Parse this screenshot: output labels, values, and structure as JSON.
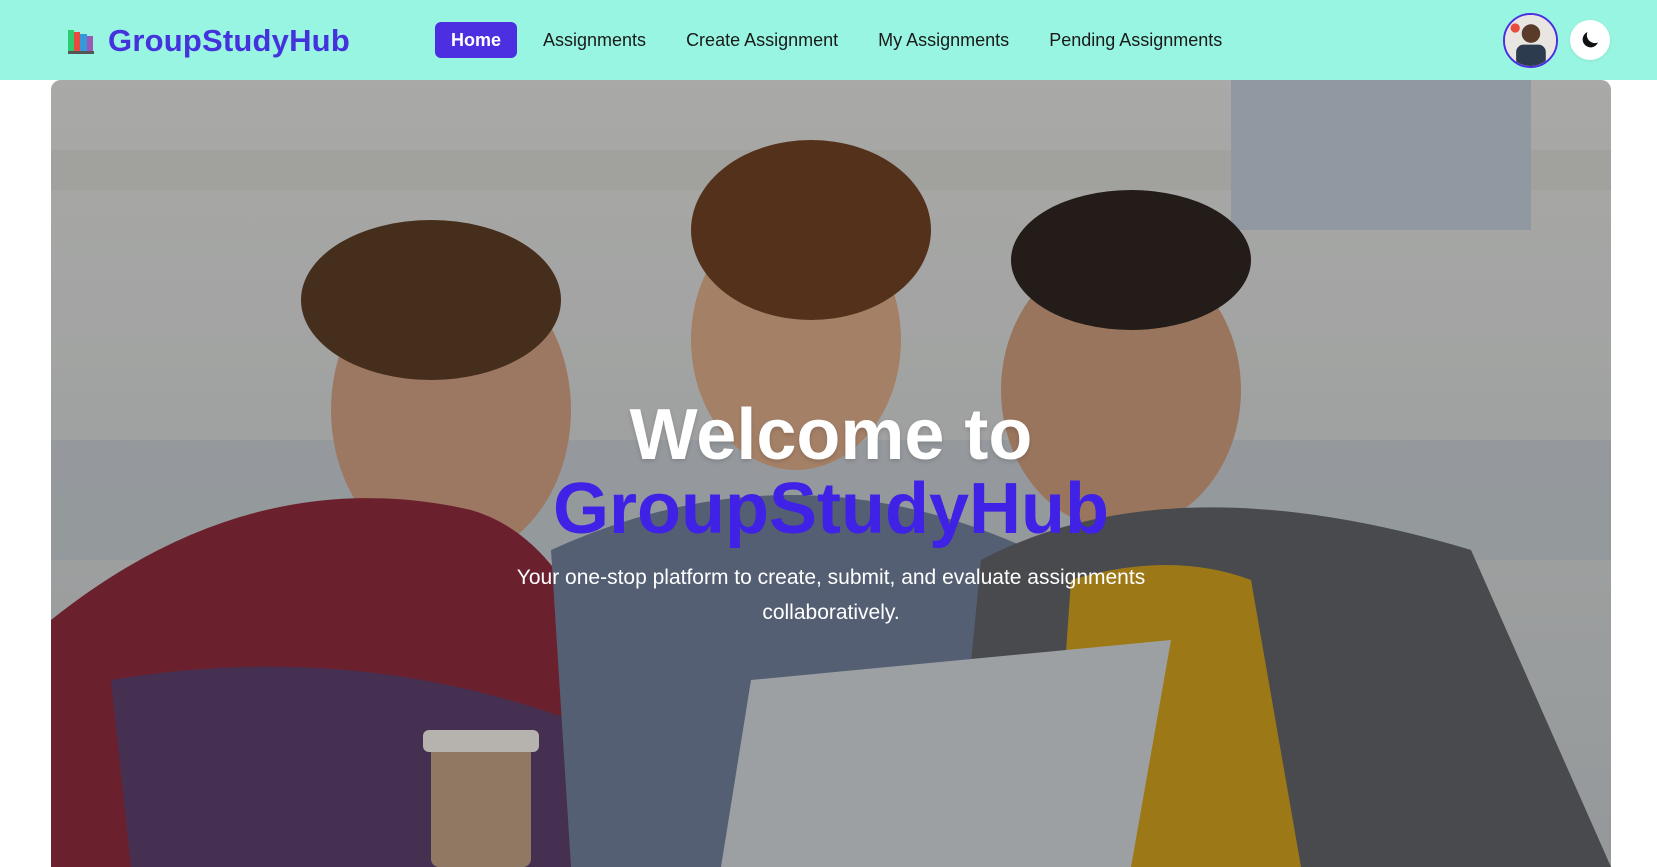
{
  "header": {
    "brand": "GroupStudyHub",
    "logo_icon": "books-icon",
    "nav": [
      {
        "label": "Home",
        "active": true
      },
      {
        "label": "Assignments",
        "active": false
      },
      {
        "label": "Create Assignment",
        "active": false
      },
      {
        "label": "My Assignments",
        "active": false
      },
      {
        "label": "Pending Assignments",
        "active": false
      }
    ],
    "avatar_icon": "user-avatar",
    "theme_toggle_icon": "moon-icon"
  },
  "hero": {
    "title": "Welcome to",
    "brand": "GroupStudyHub",
    "subtitle": "Your one-stop platform to create, submit, and evaluate assignments collaboratively."
  },
  "colors": {
    "navbar_bg": "#98f5e1",
    "accent": "#4b2fe0",
    "brand_text": "#4433dd"
  }
}
